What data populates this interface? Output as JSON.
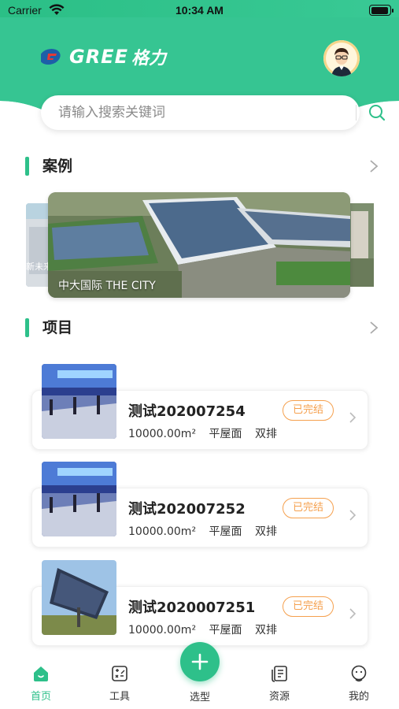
{
  "status_bar": {
    "carrier": "Carrier",
    "time": "10:34 AM"
  },
  "header": {
    "logo_text": "GREE",
    "logo_sub": "格力",
    "accent_color": "#2ec08a"
  },
  "search": {
    "placeholder": "请输入搜索关键词"
  },
  "sections": {
    "cases": {
      "title": "案例"
    },
    "projects": {
      "title": "项目"
    }
  },
  "cases": {
    "main_caption": "中大国际 THE CITY",
    "left_caption": "新未来"
  },
  "projects": [
    {
      "name": "测试202007254",
      "area": "10000.00m²",
      "roof": "平屋面",
      "row": "双排",
      "status": "已完结",
      "thumb": "station-icon"
    },
    {
      "name": "测试202007252",
      "area": "10000.00m²",
      "roof": "平屋面",
      "row": "双排",
      "status": "已完结",
      "thumb": "station-icon"
    },
    {
      "name": "测试2020007251",
      "area": "10000.00m²",
      "roof": "平屋面",
      "row": "双排",
      "status": "已完结",
      "thumb": "solar-panel-icon"
    }
  ],
  "tabbar": {
    "home": "首页",
    "tools": "工具",
    "select": "选型",
    "resources": "资源",
    "mine": "我的"
  }
}
